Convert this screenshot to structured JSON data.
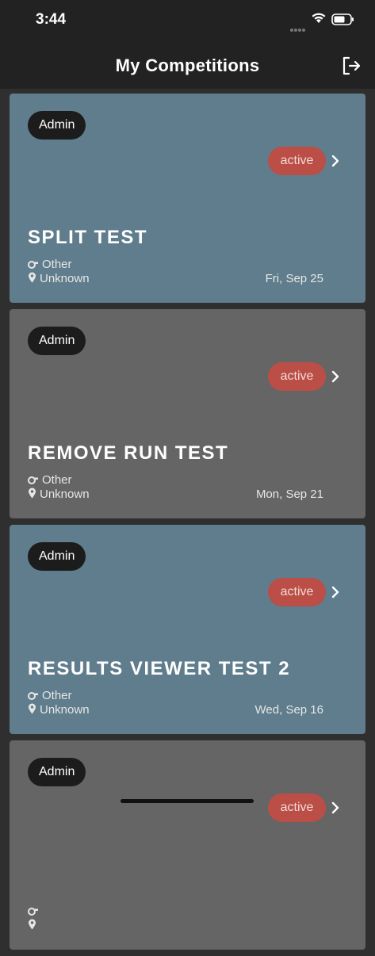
{
  "status_bar": {
    "time": "3:44"
  },
  "header": {
    "title": "My Competitions"
  },
  "competitions": [
    {
      "role": "Admin",
      "status": "active",
      "name": "SPLIT TEST",
      "sport": "Other",
      "location": "Unknown",
      "date": "Fri, Sep 25",
      "color": "#5f7d8c"
    },
    {
      "role": "Admin",
      "status": "active",
      "name": "REMOVE RUN TEST",
      "sport": "Other",
      "location": "Unknown",
      "date": "Mon, Sep 21",
      "color": "#656565"
    },
    {
      "role": "Admin",
      "status": "active",
      "name": "RESULTS VIEWER TEST 2",
      "sport": "Other",
      "location": "Unknown",
      "date": "Wed, Sep 16",
      "color": "#5f7d8c"
    },
    {
      "role": "Admin",
      "status": "active",
      "name": "",
      "sport": "",
      "location": "",
      "date": "",
      "color": "#656565"
    }
  ],
  "colors": {
    "status_active": "#bb4e46",
    "badge_bg": "#1c1c1c",
    "bar_bg": "#222222"
  }
}
